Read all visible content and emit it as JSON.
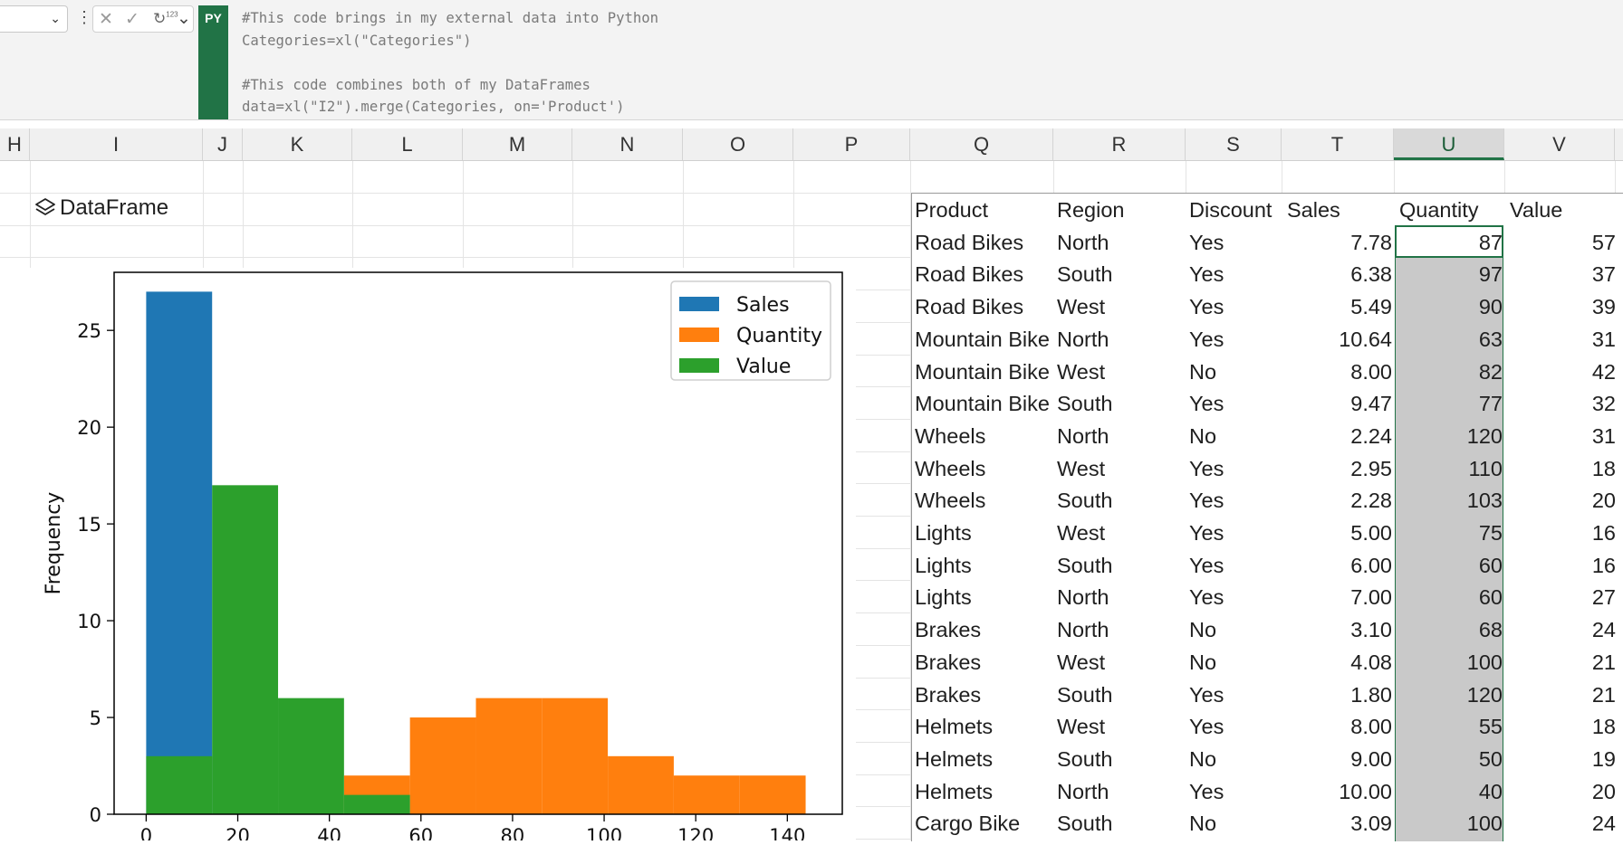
{
  "formula_bar": {
    "py_badge": "PY",
    "code_lines": [
      "#This code brings in my external data into Python",
      "Categories=xl(\"Categories\")",
      "",
      "#This code combines both of my DataFrames",
      "data=xl(\"I2\").merge(Categories, on='Product')"
    ],
    "controls": {
      "cancel": "✕",
      "enter": "✓",
      "type_icon": "↻",
      "type_sup": "123",
      "chevron": "⌄"
    }
  },
  "columns": [
    "H",
    "I",
    "J",
    "K",
    "L",
    "M",
    "N",
    "O",
    "P",
    "Q",
    "R",
    "S",
    "T",
    "U",
    "V"
  ],
  "selected_column": "U",
  "dataframe_label": "DataFrame",
  "chart_data": {
    "type": "histogram",
    "ylabel": "Frequency",
    "xlabel": "",
    "ylim": [
      0,
      28
    ],
    "xlim": [
      -7,
      152
    ],
    "x_ticks": [
      0,
      20,
      40,
      60,
      80,
      100,
      120,
      140
    ],
    "y_ticks": [
      0,
      5,
      10,
      15,
      20,
      25
    ],
    "legend_position": "top-right",
    "series": [
      {
        "name": "Sales",
        "color": "#1f77b4",
        "bins": [
          [
            0,
            14.4,
            27
          ]
        ]
      },
      {
        "name": "Quantity",
        "color": "#ff7f0e",
        "bins": [
          [
            43.2,
            57.6,
            2
          ],
          [
            57.6,
            72,
            5
          ],
          [
            72,
            86.4,
            6
          ],
          [
            86.4,
            100.8,
            6
          ],
          [
            100.8,
            115.2,
            3
          ],
          [
            115.2,
            129.6,
            2
          ],
          [
            129.6,
            144,
            2
          ]
        ]
      },
      {
        "name": "Value",
        "color": "#2ca02c",
        "bins": [
          [
            0,
            14.4,
            3
          ],
          [
            14.4,
            28.8,
            17
          ],
          [
            28.8,
            43.2,
            6
          ],
          [
            43.2,
            57.6,
            1
          ]
        ]
      }
    ]
  },
  "table": {
    "headers": [
      "Product",
      "Region",
      "Discount",
      "Sales",
      "Quantity",
      "Value",
      ""
    ],
    "rows": [
      [
        "Road Bikes",
        "North",
        "Yes",
        "7.78",
        "87",
        "57",
        "",
        ""
      ],
      [
        "Road Bikes",
        "South",
        "Yes",
        "6.38",
        "97",
        "37",
        "",
        ""
      ],
      [
        "Road Bikes",
        "West",
        "Yes",
        "5.49",
        "90",
        "39",
        "",
        ""
      ],
      [
        "Mountain Bike",
        "North",
        "Yes",
        "10.64",
        "63",
        "31",
        "",
        ""
      ],
      [
        "Mountain Bike",
        "West",
        "No",
        "8.00",
        "82",
        "42",
        "",
        ""
      ],
      [
        "Mountain Bike",
        "South",
        "Yes",
        "9.47",
        "77",
        "32",
        "",
        ""
      ],
      [
        "Wheels",
        "North",
        "No",
        "2.24",
        "120",
        "31",
        "",
        ""
      ],
      [
        "Wheels",
        "West",
        "Yes",
        "2.95",
        "110",
        "18",
        "",
        ""
      ],
      [
        "Wheels",
        "South",
        "Yes",
        "2.28",
        "103",
        "20",
        "",
        ""
      ],
      [
        "Lights",
        "West",
        "Yes",
        "5.00",
        "75",
        "16",
        "",
        ""
      ],
      [
        "Lights",
        "South",
        "Yes",
        "6.00",
        "60",
        "16",
        "",
        ""
      ],
      [
        "Lights",
        "North",
        "Yes",
        "7.00",
        "60",
        "27",
        "",
        ""
      ],
      [
        "Brakes",
        "North",
        "No",
        "3.10",
        "68",
        "24",
        "",
        ""
      ],
      [
        "Brakes",
        "West",
        "No",
        "4.08",
        "100",
        "21",
        "",
        ""
      ],
      [
        "Brakes",
        "South",
        "Yes",
        "1.80",
        "120",
        "21",
        "",
        ""
      ],
      [
        "Helmets",
        "West",
        "Yes",
        "8.00",
        "55",
        "18",
        "",
        ""
      ],
      [
        "Helmets",
        "South",
        "No",
        "9.00",
        "50",
        "19",
        "",
        ""
      ],
      [
        "Helmets",
        "North",
        "Yes",
        "10.00",
        "40",
        "20",
        "",
        ""
      ],
      [
        "Cargo Bike",
        "South",
        "No",
        "3.09",
        "100",
        "24",
        "",
        ""
      ]
    ]
  }
}
